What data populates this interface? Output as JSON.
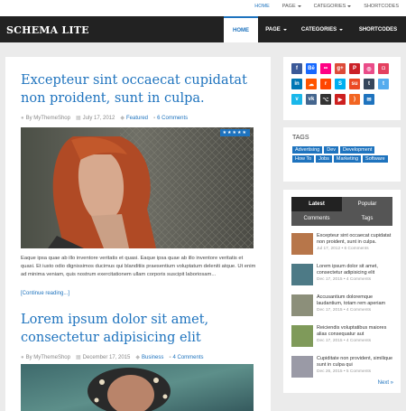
{
  "topnav": {
    "items": [
      "HOME",
      "PAGE",
      "CATEGORIES",
      "SHORTCODES"
    ]
  },
  "header": {
    "logo": "SCHEMA LITE"
  },
  "mainnav": {
    "home": "HOME",
    "page": "PAGE",
    "categories": "CATEGORIES",
    "shortcodes": "SHORTCODES"
  },
  "posts": [
    {
      "title": "Excepteur sint occaecat cupidatat non proident, sunt in culpa.",
      "author": "By MyThemeShop",
      "date": "July 17, 2012",
      "category": "Featured",
      "comments": "6 Comments",
      "rating": "★★★★★",
      "excerpt": "Eaque ipsa quae ab illo inventore veritatis et quasi. Eaque ipsa quae ab illo inventore veritatis et quasi. Et iusto odio dignissimos ducimus qui blanditiis praesentium voluptatum deleniti atque. Ut enim ad minima veniam, quis nostrum exercitationem ullam corporis suscipit laboriosam...",
      "readmore": "[Continue reading...]"
    },
    {
      "title": "Lorem ipsum dolor sit amet, consectetur adipisicing elit",
      "author": "By MyThemeShop",
      "date": "December 17, 2015",
      "category": "Business",
      "comments": "4 Comments"
    }
  ],
  "social": {
    "icons": [
      {
        "name": "facebook-icon",
        "g": "f",
        "c": "#3b5998"
      },
      {
        "name": "behance-icon",
        "g": "Bē",
        "c": "#1769ff"
      },
      {
        "name": "flickr-icon",
        "g": "••",
        "c": "#ff0084"
      },
      {
        "name": "google-plus-icon",
        "g": "g+",
        "c": "#dd4b39"
      },
      {
        "name": "pinterest-icon",
        "g": "P",
        "c": "#cb2027"
      },
      {
        "name": "dribbble-icon",
        "g": "◎",
        "c": "#ea4c89"
      },
      {
        "name": "instagram-icon",
        "g": "◘",
        "c": "#e4405f"
      },
      {
        "name": "linkedin-icon",
        "g": "in",
        "c": "#0077b5"
      },
      {
        "name": "soundcloud-icon",
        "g": "☁",
        "c": "#ff5500"
      },
      {
        "name": "reddit-icon",
        "g": "r",
        "c": "#ff4500"
      },
      {
        "name": "skype-icon",
        "g": "S",
        "c": "#00aff0"
      },
      {
        "name": "stumbleupon-icon",
        "g": "su",
        "c": "#eb4924"
      },
      {
        "name": "tumblr-icon",
        "g": "t",
        "c": "#35465c"
      },
      {
        "name": "twitter-icon",
        "g": "t",
        "c": "#55acee"
      },
      {
        "name": "vimeo-icon",
        "g": "v",
        "c": "#1ab7ea"
      },
      {
        "name": "vk-icon",
        "g": "vk",
        "c": "#45668e"
      },
      {
        "name": "github-icon",
        "g": "⌥",
        "c": "#333333"
      },
      {
        "name": "youtube-icon",
        "g": "▶",
        "c": "#cd201f"
      },
      {
        "name": "rss-icon",
        "g": ")",
        "c": "#f26522"
      },
      {
        "name": "email-icon",
        "g": "✉",
        "c": "#1e73be"
      }
    ]
  },
  "tags_widget": {
    "title": "TAGS",
    "tags": [
      "Advertising",
      "Dev",
      "Development",
      "How To",
      "Jobs",
      "Marketing",
      "Software"
    ]
  },
  "tabs_widget": {
    "tabs": [
      "Latest",
      "Popular",
      "Comments",
      "Tags"
    ],
    "items": [
      {
        "title": "Excepteur sint occaecat cupidatat non proident, sunt in culpa.",
        "date": "Jul 17, 2012",
        "comments": "6 Comments",
        "color": "#b7764a"
      },
      {
        "title": "Lorem ipsum dolor sit amet, consectetur adipisicing elit",
        "date": "Dec 17, 2015",
        "comments": "4 Comments",
        "color": "#4d7a86"
      },
      {
        "title": "Accusantium doloremque laudantium, totam rem aperiam",
        "date": "Dec 17, 2015",
        "comments": "4 Comments",
        "color": "#8c8f7a"
      },
      {
        "title": "Reiciendis voluptatibus maiores alias consequatur aut",
        "date": "Dec 17, 2015",
        "comments": "4 Comments",
        "color": "#7f9a5a"
      },
      {
        "title": "Cupiditate non provident, similique sunt in culpa qui",
        "date": "Dec 26, 2015",
        "comments": "5 Comments",
        "color": "#9a9aa6"
      }
    ],
    "next": "Next »"
  },
  "accent": "#1e73be"
}
